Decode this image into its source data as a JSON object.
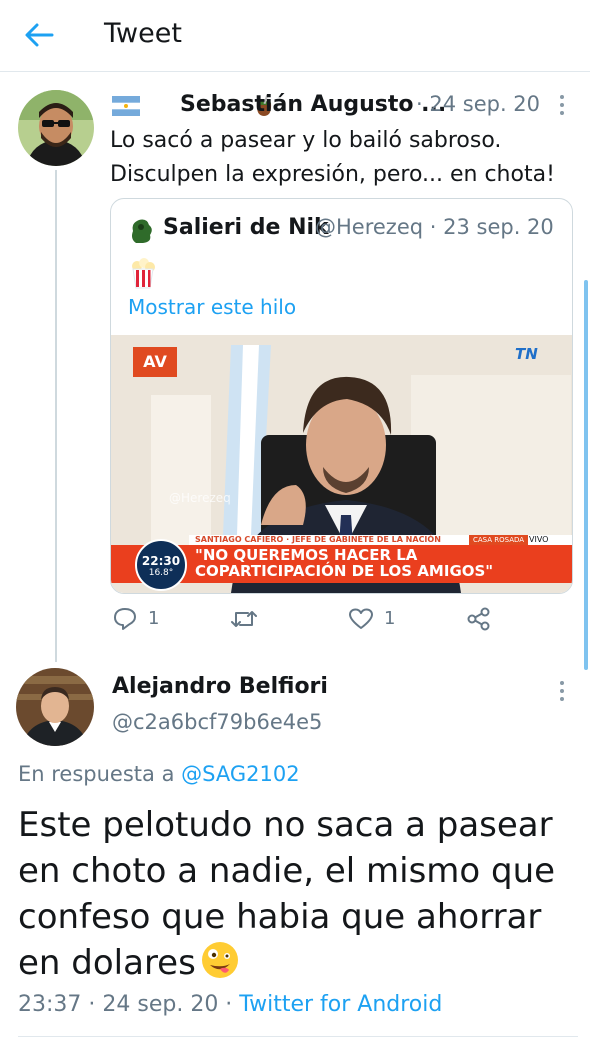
{
  "header": {
    "title": "Tweet"
  },
  "tweet": {
    "author_name": "Sebastián Augusto ...",
    "date": "· 24 sep. 20",
    "text": "Lo sacó a pasear y lo bailó sabroso. Disculpen la expresión, pero... en chota!",
    "quote": {
      "author_name": "Salieri de Nik",
      "handle_date": "@Herezeq · 23 sep. 20",
      "show_thread": "Mostrar este hilo",
      "image": {
        "channel_logo": "AV",
        "network_logo": "TN",
        "watermark": "@Herezeq",
        "lower_third_name": "SANTIAGO CAFIERO · JEFE DE GABINETE DE LA NACIÓN",
        "location": "CASA ROSADA",
        "live": "VIVO",
        "headline_line1": "\"NO QUEREMOS HACER LA",
        "headline_line2": "COPARTICIPACIÓN DE LOS AMIGOS\"",
        "clock_time": "22:30",
        "clock_temp": "16.8°"
      }
    },
    "actions": {
      "reply_count": "1",
      "like_count": "1"
    },
    "icons": {
      "reply": "reply-icon",
      "retweet": "retweet-icon",
      "like": "heart-icon",
      "share": "share-icon"
    }
  },
  "reply": {
    "author_name": "Alejandro Belfiori",
    "handle": "@c2a6bcf79b6e4e5",
    "in_reply_prefix": "En respuesta a",
    "in_reply_handle": "@SAG2102",
    "text": "Este pelotudo no saca a pasear en choto a nadie, el mismo que confeso que habia que ahorrar en dolares",
    "time": "23:37 · 24 sep. 20 ·",
    "source": "Twitter for Android"
  },
  "colors": {
    "accent": "#1da1f2",
    "muted": "#657786",
    "border": "#cfd9de"
  }
}
